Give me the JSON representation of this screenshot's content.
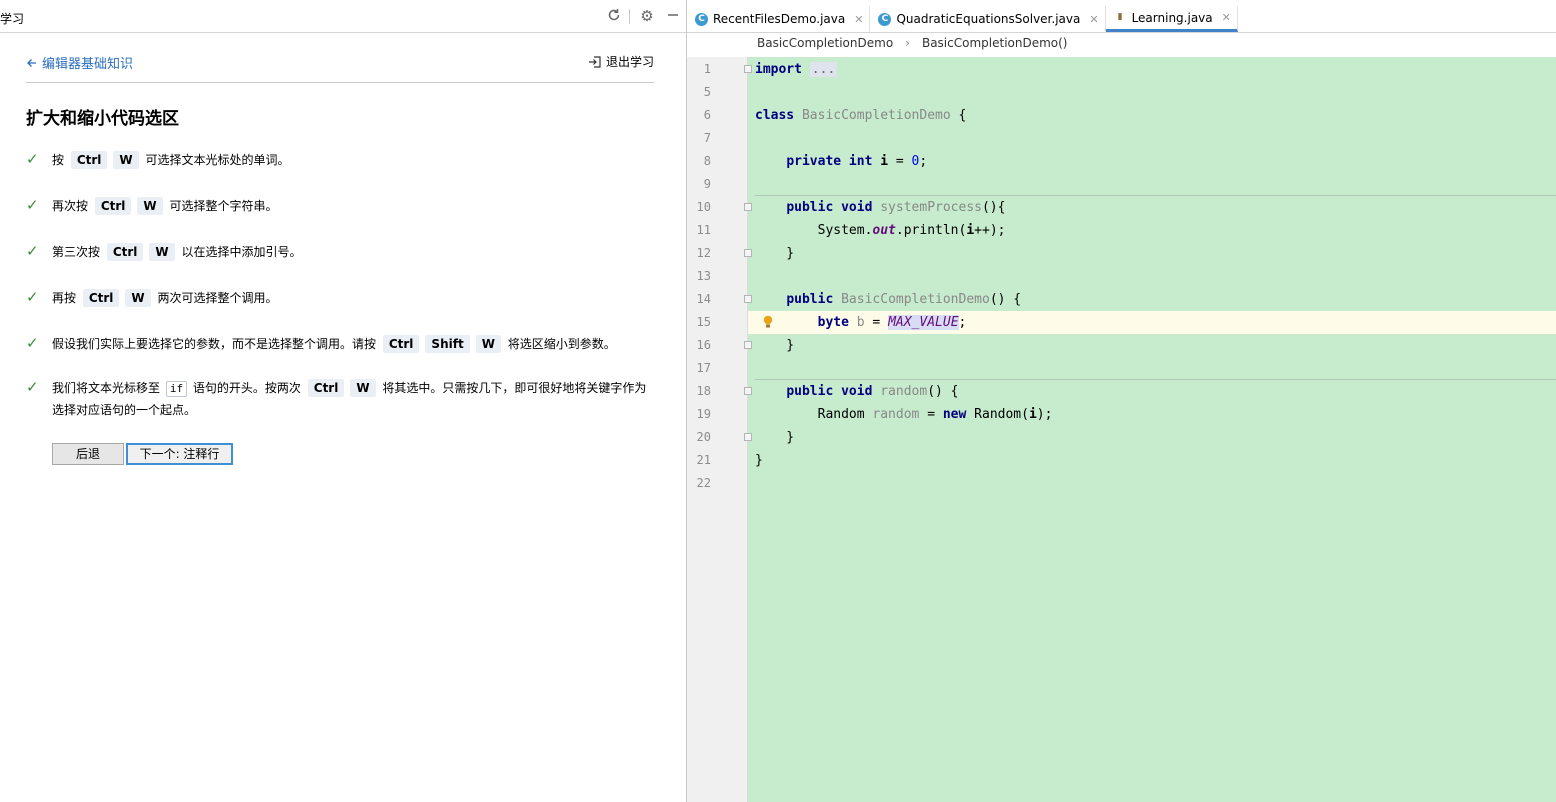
{
  "learning_panel": {
    "title": "学习",
    "back_label": "编辑器基础知识",
    "exit_label": "退出学习",
    "lesson_title": "扩大和缩小代码选区",
    "steps": [
      {
        "before": "按",
        "keys": [
          "Ctrl",
          "W"
        ],
        "after": "可选择文本光标处的单词。"
      },
      {
        "before": "再次按",
        "keys": [
          "Ctrl",
          "W"
        ],
        "after": "可选择整个字符串。"
      },
      {
        "before": "第三次按",
        "keys": [
          "Ctrl",
          "W"
        ],
        "after": "以在选择中添加引号。"
      },
      {
        "before": "再按",
        "keys": [
          "Ctrl",
          "W"
        ],
        "after": "两次可选择整个调用。"
      },
      {
        "before": "假设我们实际上要选择它的参数，而不是选择整个调用。请按",
        "keys": [
          "Ctrl",
          "Shift",
          "W"
        ],
        "after": "将选区缩小到参数。"
      },
      {
        "before": "我们将文本光标移至",
        "code": "if",
        "middle": "语句的开头。按两次",
        "keys": [
          "Ctrl",
          "W"
        ],
        "after": "将其选中。只需按几下，即可很好地将关键字作为选择对应语句的一个起点。"
      }
    ],
    "back_button": "后退",
    "next_button": "下一个: 注释行"
  },
  "editor": {
    "tabs": [
      {
        "label": "RecentFilesDemo.java",
        "active": false
      },
      {
        "label": "QuadraticEquationsSolver.java",
        "active": false
      },
      {
        "label": "Learning.java",
        "active": true
      }
    ],
    "breadcrumbs": [
      "BasicCompletionDemo",
      "BasicCompletionDemo()"
    ],
    "current_line": 15,
    "lines": [
      {
        "n": "1",
        "html": "<span class=\"kw\">import</span> <span class=\"fold\">...</span>"
      },
      {
        "n": "5",
        "html": ""
      },
      {
        "n": "6",
        "html": "<span class=\"kw\">class</span> <span class=\"gray\">BasicCompletionDemo</span> {"
      },
      {
        "n": "7",
        "html": ""
      },
      {
        "n": "8",
        "html": "    <span class=\"kw\">private int</span> <span class=\"var\">i</span> = <span class=\"num\">0</span>;"
      },
      {
        "n": "9",
        "html": ""
      },
      {
        "n": "10",
        "html": "    <span class=\"kw\">public void</span> <span class=\"gray\">systemProcess</span>(){"
      },
      {
        "n": "11",
        "html": "        System.<span class=\"field\">out</span>.println(<span class=\"var\">i</span>++);"
      },
      {
        "n": "12",
        "html": "    }"
      },
      {
        "n": "13",
        "html": ""
      },
      {
        "n": "14",
        "html": "    <span class=\"kw\">public</span> <span class=\"gray\">BasicCompletionDemo</span>() {"
      },
      {
        "n": "15",
        "html": "        <span class=\"kw\">byte</span> <span class=\"gray\">b</span> = <span class=\"const\">MAX_VALUE</span>;"
      },
      {
        "n": "16",
        "html": "    }"
      },
      {
        "n": "17",
        "html": ""
      },
      {
        "n": "18",
        "html": "    <span class=\"kw\">public void</span> <span class=\"gray\">random</span>() {"
      },
      {
        "n": "19",
        "html": "        Random <span class=\"gray\">random</span> = <span class=\"kw\">new</span> Random(<span class=\"var\">i</span>);"
      },
      {
        "n": "20",
        "html": "    }"
      },
      {
        "n": "21",
        "html": "}"
      },
      {
        "n": "22",
        "html": ""
      }
    ]
  }
}
